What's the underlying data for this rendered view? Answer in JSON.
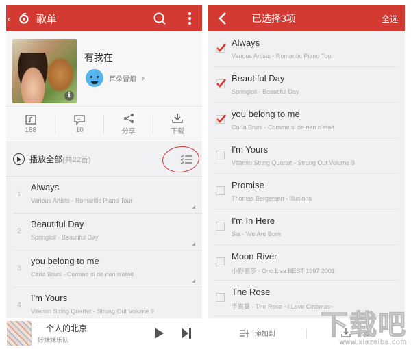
{
  "left": {
    "topbar": {
      "back_icon": "chevron-left-icon",
      "logo_icon": "netease-music-logo",
      "title": "歌单",
      "search_icon": "search-icon",
      "more_icon": "more-vertical-icon"
    },
    "playlist": {
      "name": "有我在",
      "creator": "耳朵冒烟",
      "creator_chevron": "›",
      "info_badge": "i"
    },
    "stats": [
      {
        "icon": "folder-music-icon",
        "label": "188"
      },
      {
        "icon": "comment-icon",
        "label": "10"
      },
      {
        "icon": "share-icon",
        "label": "分享"
      },
      {
        "icon": "download-icon",
        "label": "下载"
      }
    ],
    "play_all": {
      "label": "播放全部",
      "count": "(共22首)",
      "multi_select_icon": "checklist-icon"
    },
    "songs": [
      {
        "index": "1",
        "title": "Always",
        "subtitle": "Various Artists - Romantic Piano Tour"
      },
      {
        "index": "2",
        "title": "Beautiful Day",
        "subtitle": "Springloll - Beautiful Day"
      },
      {
        "index": "3",
        "title": "you belong to me",
        "subtitle": "Carla Bruni - Comme si de rien n'etait"
      },
      {
        "index": "4",
        "title": "I'm Yours",
        "subtitle": "Vitamin String Quartet - Strung Out Volume 9"
      }
    ],
    "now_playing": {
      "title": "一个人的北京",
      "artist": "好妹妹乐队"
    }
  },
  "right": {
    "topbar": {
      "title": "已选择3项",
      "select_all": "全选"
    },
    "songs": [
      {
        "title": "Always",
        "subtitle": "Various Artists - Romantic Piano Tour",
        "checked": true
      },
      {
        "title": "Beautiful Day",
        "subtitle": "Springloll - Beautiful Day",
        "checked": true
      },
      {
        "title": "you belong to me",
        "subtitle": "Carla Bruni - Comme si de rien n'etait",
        "checked": true
      },
      {
        "title": "I'm Yours",
        "subtitle": "Vitamin String Quartet - Strung Out Volume 9",
        "checked": false
      },
      {
        "title": "Promise",
        "subtitle": "Thomas Bergersen - Illusions",
        "checked": false
      },
      {
        "title": "I'm In Here",
        "subtitle": "Sia - We Are Born",
        "checked": false
      },
      {
        "title": "Moon River",
        "subtitle": "小野丽莎 - Ono Lisa BEST 1997 2001",
        "checked": false
      },
      {
        "title": "The Rose",
        "subtitle": "手嶌葵 - The Rose ~I Love Cinemas~",
        "checked": false
      }
    ],
    "actions": {
      "add_to": "添加到",
      "download": "下载"
    }
  },
  "watermark": {
    "text": "下载吧",
    "url": "www.xiazaiba.com"
  },
  "colors": {
    "accent": "#d33a31",
    "background": "#f1f1f3",
    "annotation_circle": "#d03030"
  }
}
